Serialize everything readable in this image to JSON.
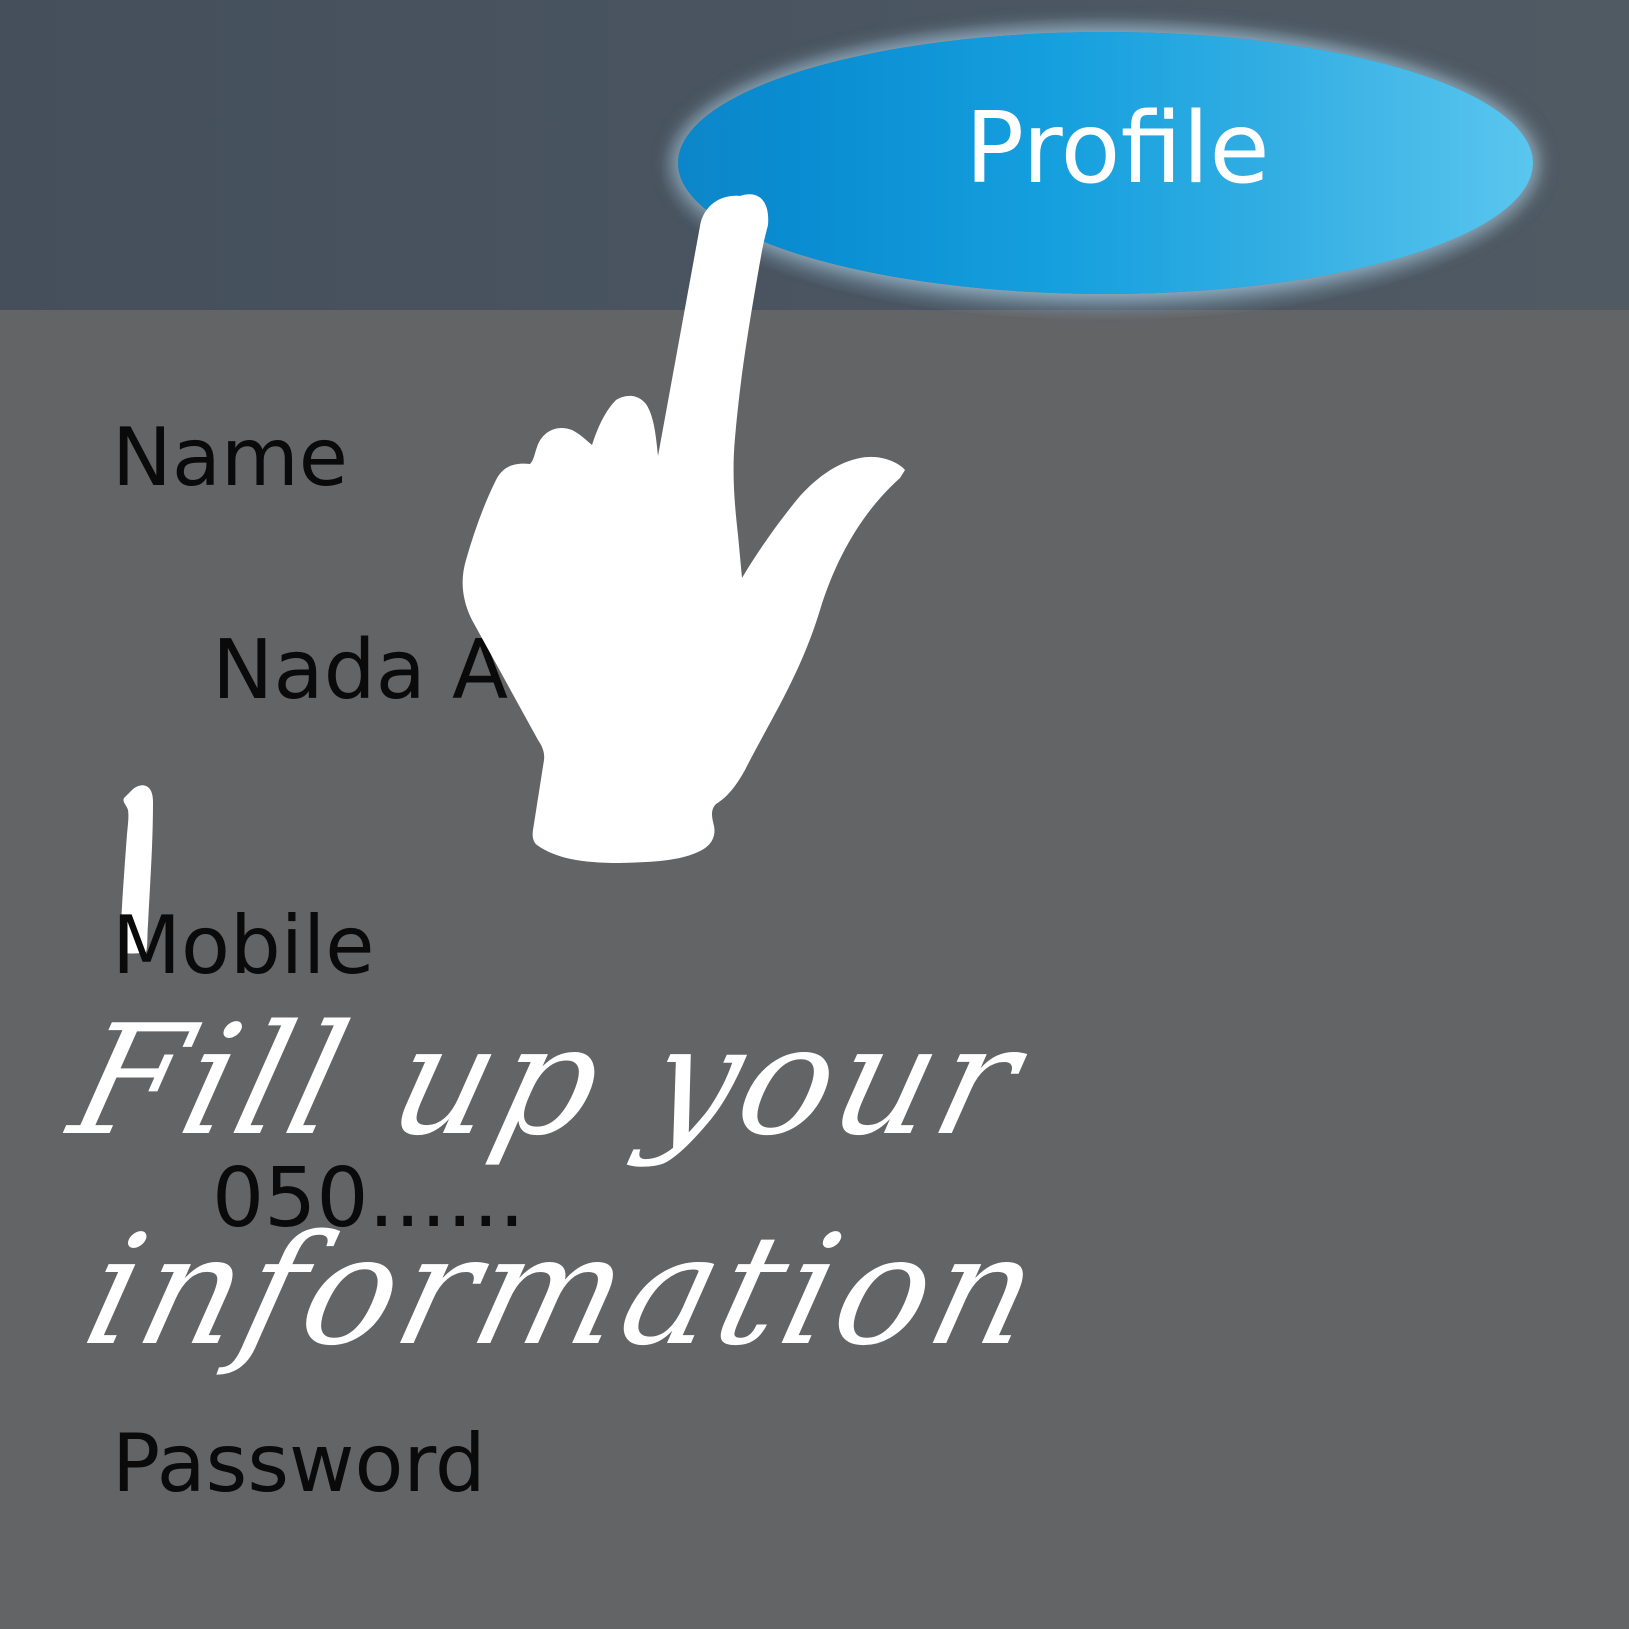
{
  "header": {
    "profile_button_label": "Profile"
  },
  "form": {
    "name": {
      "label": "Name",
      "value": "Nada A"
    },
    "mobile": {
      "label": "Mobile",
      "value": "050......"
    },
    "password": {
      "label": "Password"
    }
  },
  "caption": {
    "line1": "Fill up your",
    "line2": "information"
  },
  "icons": {
    "pointer": "pointing-hand-icon",
    "text_cursor": "text-cursor-icon"
  },
  "colors": {
    "background": "#636466",
    "header": "#4b5662",
    "accent": "#16a0de",
    "label_text": "#0a0a0a",
    "handwriting": "#ffffff"
  }
}
